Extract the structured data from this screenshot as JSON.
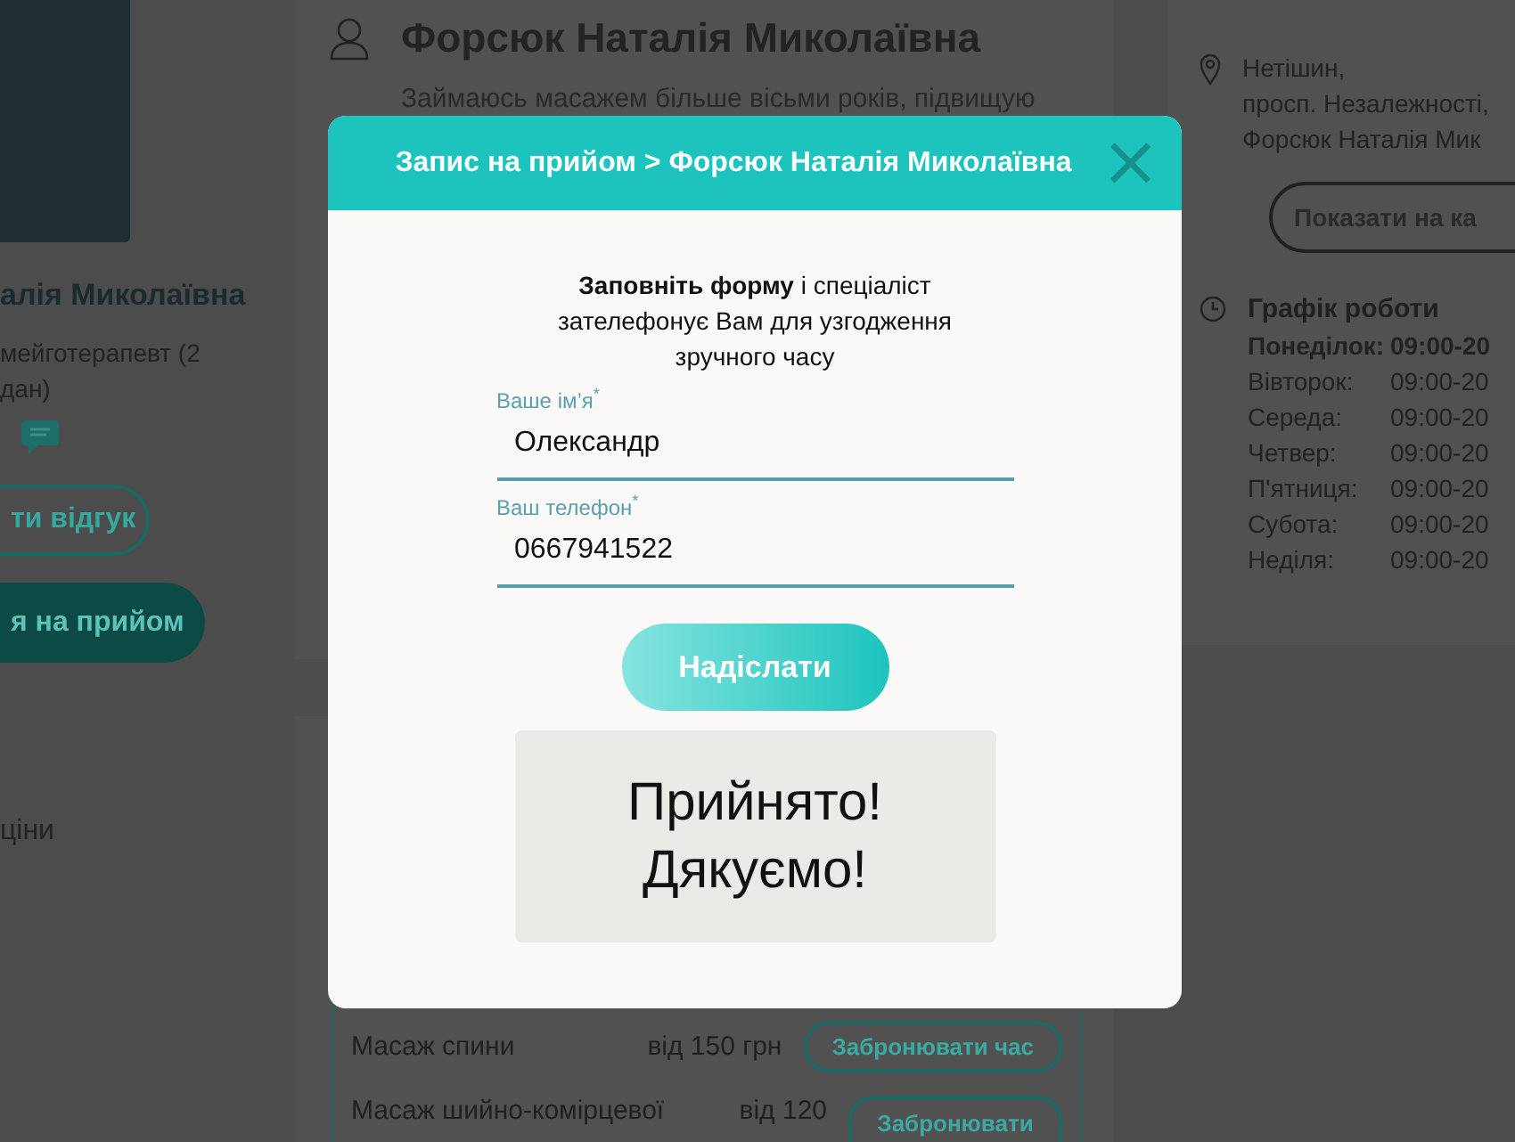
{
  "profile_sidebar": {
    "name": "алія Миколаївна",
    "specialty": "мейготерапевт (2 дан)",
    "review_button": "ти відгук",
    "book_button": "я на прийом",
    "prices_link": "ціни"
  },
  "doctor_card": {
    "name": "Форсюк Наталія Миколаївна",
    "bio": "Займаюсь масажем більше вісьми років, підвищую"
  },
  "services": [
    {
      "name": "Масаж спини",
      "price": "від 150 грн",
      "button": "Забронювати час"
    },
    {
      "name": "Масаж шийно-комірцевої",
      "price": "від 120",
      "button": "Забронювати"
    }
  ],
  "location": {
    "address": [
      "Нетішин,",
      "просп. Незалежності,",
      "Форсюк Наталія Мик"
    ],
    "map_button": "Показати на ка"
  },
  "schedule": {
    "title": "Графік роботи",
    "days": [
      {
        "day": "Понеділок:",
        "hours": "09:00-20",
        "today": true
      },
      {
        "day": "Вівторок:",
        "hours": "09:00-20",
        "today": false
      },
      {
        "day": "Середа:",
        "hours": "09:00-20",
        "today": false
      },
      {
        "day": "Четвер:",
        "hours": "09:00-20",
        "today": false
      },
      {
        "day": "П'ятниця:",
        "hours": "09:00-20",
        "today": false
      },
      {
        "day": "Субота:",
        "hours": "09:00-20",
        "today": false
      },
      {
        "day": "Неділя:",
        "hours": "09:00-20",
        "today": false
      }
    ]
  },
  "modal": {
    "title": "Запис на прийом > Форсюк Наталія Миколаївна",
    "close": "×",
    "intro": "**Заповніть форму** і спеціаліст зателефонує Вам для узгодження зручного часу",
    "fields": [
      {
        "label": "Ваше ім’я$^{*}$",
        "value": "Олександр"
      },
      {
        "label": "Ваш телефон$^{*}$",
        "value": "0667941522"
      }
    ],
    "submit": "Надіслати",
    "success": "Прийнято! Дякуємо!"
  }
}
